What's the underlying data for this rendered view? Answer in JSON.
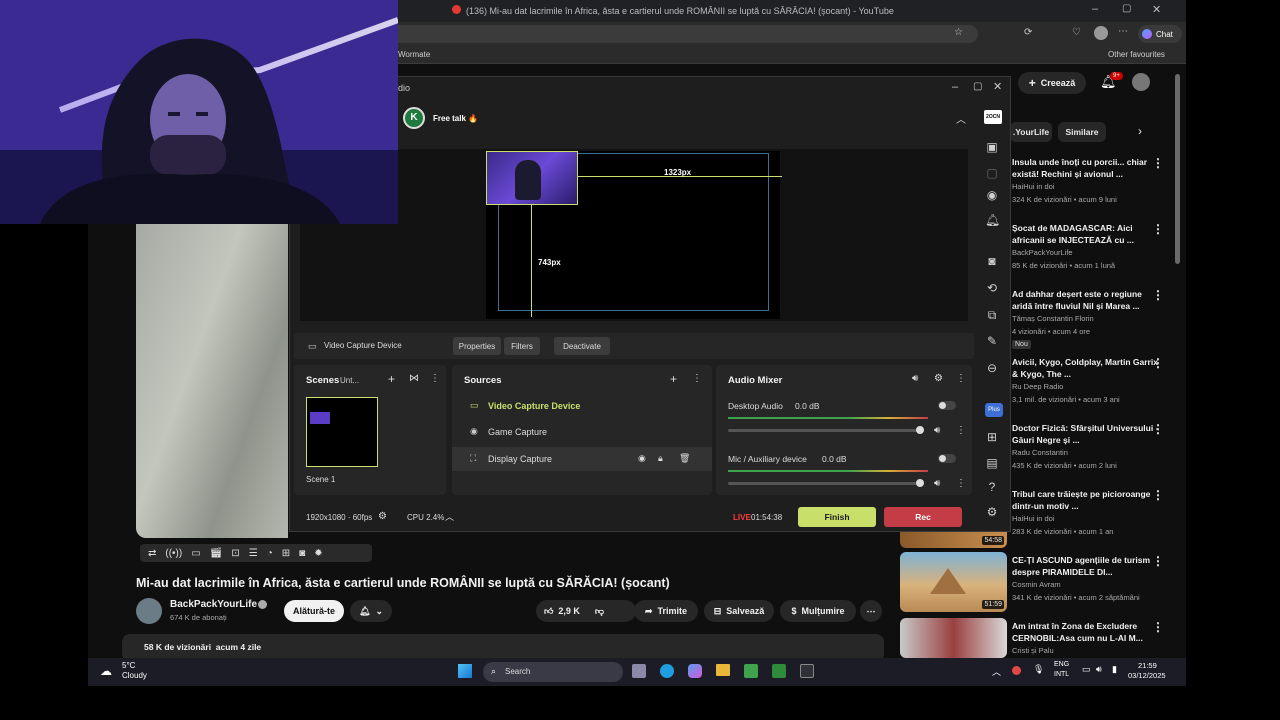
{
  "browser": {
    "tab_title": "(136) Mi-au dat lacrimile în Africa, ăsta e cartierul unde ROMÂNII se luptă cu SĂRĂCIA! (șocant) - YouTube",
    "chat_label": "Chat",
    "bookmarks": {
      "left": "Wormate",
      "right": "Other favourites"
    }
  },
  "youtube": {
    "create_label": "Creează",
    "notif_count": "9+",
    "chips": [
      ".YourLife",
      "Similare"
    ],
    "video_title": "Mi-au dat lacrimile în Africa, ăsta e cartierul unde ROMÂNII se luptă cu SĂRĂCIA! (șocant)",
    "channel_name": "BackPackYourLife",
    "subscribers": "674 K de abonați",
    "join_label": "Alătură-te",
    "like_count": "2,9 K",
    "share_label": "Trimite",
    "save_label": "Salvează",
    "thanks_label": "Mulțumire",
    "views_line": "58 K de vizionări  acum 4 zile",
    "sidebar": [
      {
        "title": "Insula unde înoți cu porcii... chiar există! Rechini și avionul ...",
        "channel": "HaiHui in doi",
        "meta": "324 K de vizionări • acum 9 luni"
      },
      {
        "title": "Șocat de MADAGASCAR: Aici africanii se INJECTEAZĂ cu ...",
        "channel": "BackPackYourLife",
        "meta": "85 K de vizionări • acum 1 lună"
      },
      {
        "title": "Ad dahhar deșert este o regiune aridă între fluviul Nil și Marea ...",
        "channel": "Tămaș Constantin Florin",
        "meta": "4 vizionări • acum 4 ore",
        "badge": "Nou"
      },
      {
        "title": "Avicii, Kygo, Coldplay, Martin Garrix & Kygo, The ...",
        "channel": "Ru Deep Radio",
        "meta": "3,1 mil. de vizionări • acum 3 ani"
      },
      {
        "title": "Doctor Fizică: Sfârșitul Universului - Găuri Negre și ...",
        "channel": "Radu Constantin",
        "meta": "435 K de vizionări • acum 2 luni"
      },
      {
        "title": "Tribul care trăiește pe picioroange dintr-un motiv ...",
        "channel": "HaiHui in doi",
        "meta": "283 K de vizionări • acum 1 an"
      },
      {
        "title": "CE-ȚI ASCUND agențiile de turism despre PIRAMIDELE DI...",
        "channel": "Cosmin Avram",
        "meta": "341 K de vizionări • acum 2 săptămâni"
      },
      {
        "title": "Am intrat în Zona de Excludere CERNOBIL:Asa cum nu L-AI M...",
        "channel": "Cristi și Palu",
        "meta": ""
      }
    ],
    "thumb_durations": [
      "54:58",
      "51:59"
    ]
  },
  "obs": {
    "title_fragment": "dio",
    "profile_name": "Free talk 🔥",
    "canvas_width_label": "1323px",
    "canvas_height_label": "743px",
    "selected_source_label": "Video Capture Device",
    "properties_label": "Properties",
    "filters_label": "Filters",
    "deactivate_label": "Deactivate",
    "scenes_title": "Scenes",
    "scenes_dropdown": "Unt...",
    "scene_name": "Scene 1",
    "sources_title": "Sources",
    "sources": [
      "Video Capture Device",
      "Game Capture",
      "Display Capture"
    ],
    "mixer_title": "Audio Mixer",
    "mixer_channels": [
      {
        "name": "Desktop Audio",
        "db": "0.0 dB",
        "level": 1.0
      },
      {
        "name": "Mic / Auxiliary device",
        "db": "0.0 dB",
        "level": 1.0
      }
    ],
    "resolution": "1920x1080 · 60fps",
    "cpu": "CPU 2.4%",
    "live_label": "LIVE",
    "live_time": "01:54:38",
    "finish_label": "Finish",
    "rec_label": "Rec",
    "side_logo": "2OCN",
    "plus_label": "Plus"
  },
  "taskbar": {
    "weather_temp": "5°C",
    "weather_desc": "Cloudy",
    "search_placeholder": "Search",
    "lang_top": "ENG",
    "lang_bottom": "INTL",
    "time": "21:59",
    "date": "03/12/2025"
  },
  "colors": {
    "accent_green": "#c8e06a",
    "rec_red": "#c43c46",
    "live_red": "#ff3b3b",
    "taskbar": "#1c1c26"
  }
}
